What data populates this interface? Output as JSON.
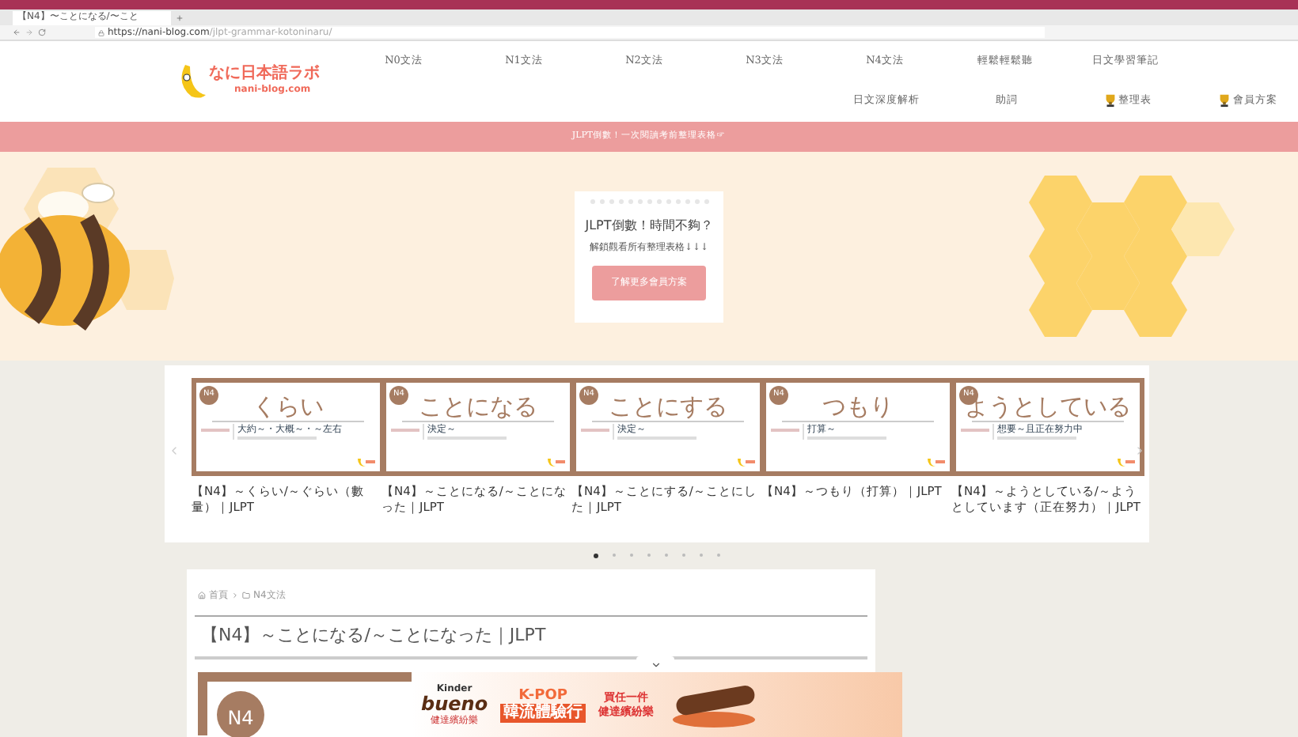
{
  "browser": {
    "tab_title": "【N4】〜ことになる/〜こと",
    "url_host": "https://nani-blog.com",
    "url_path": "/jlpt-grammar-kotoninaru/"
  },
  "header": {
    "logo_name": "なに日本語ラボ",
    "logo_domain": "nani-blog.com",
    "nav_rows": [
      [
        {
          "label": "N0文法",
          "kind": "text"
        },
        {
          "label": "N1文法",
          "kind": "text"
        },
        {
          "label": "N2文法",
          "kind": "text"
        },
        {
          "label": "N3文法",
          "kind": "text"
        },
        {
          "label": "N4文法",
          "kind": "text"
        },
        {
          "label": "輕鬆輕鬆聽",
          "kind": "text"
        },
        {
          "label": "日文學習筆記",
          "kind": "text"
        }
      ],
      [
        {
          "label": "日文深度解析",
          "kind": "text"
        },
        {
          "label": "助詞",
          "kind": "text"
        },
        {
          "label": "整理表",
          "kind": "icon"
        },
        {
          "label": "會員方案",
          "kind": "icon"
        }
      ]
    ]
  },
  "announcement": "JLPT倒數！一次閱讀考前整理表格☞",
  "hero": {
    "title": "JLPT倒數！時間不夠？",
    "subtitle": "解鎖觀看所有整理表格↓↓↓",
    "button": "了解更多會員方案"
  },
  "carousel": {
    "cards": [
      {
        "badge": "N4",
        "word": "くらい",
        "meaning": "大約～・大概～・～左右",
        "caption": "【N4】～くらい/～ぐらい（數量）｜JLPT"
      },
      {
        "badge": "N4",
        "word": "ことになる",
        "meaning": "決定～",
        "caption": "【N4】～ことになる/～ことになった｜JLPT"
      },
      {
        "badge": "N4",
        "word": "ことにする",
        "meaning": "決定～",
        "caption": "【N4】～ことにする/～ことにした｜JLPT"
      },
      {
        "badge": "N4",
        "word": "つもり",
        "meaning": "打算～",
        "caption": "【N4】～つもり（打算）｜JLPT"
      },
      {
        "badge": "N4",
        "word": "ようとしている",
        "meaning": "想要～且正在努力中",
        "caption": "【N4】～ようとしている/～ようとしています（正在努力）｜JLPT"
      }
    ],
    "dots": [
      {
        "selected": true
      },
      {
        "selected": false
      },
      {
        "selected": false
      },
      {
        "selected": false
      },
      {
        "selected": false
      },
      {
        "selected": false
      },
      {
        "selected": false
      },
      {
        "selected": false
      }
    ]
  },
  "article": {
    "breadcrumb": [
      "首頁",
      "N4文法"
    ],
    "title": "【N4】～ことになる/～ことになった｜JLPT",
    "badge": "N4"
  },
  "ad": {
    "brand_top": "Kinder",
    "brand": "bueno",
    "brand_sub": "健達繽紛樂",
    "headline_top": "K-POP",
    "headline": "韓流體驗行",
    "offer_top": "買任一件",
    "offer": "健達繽紛樂"
  }
}
